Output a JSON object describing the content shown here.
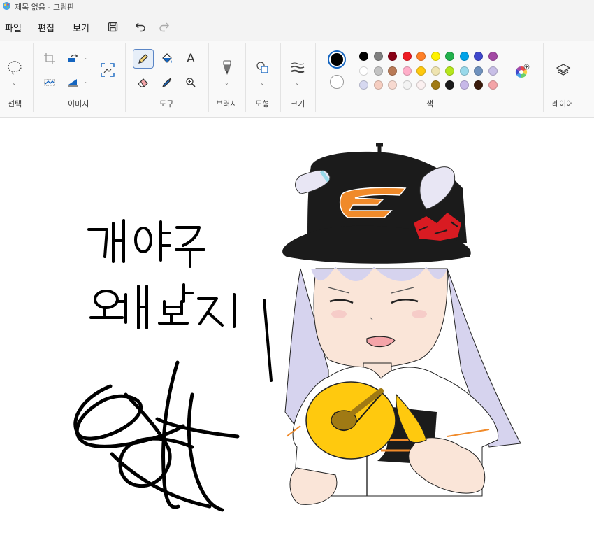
{
  "window": {
    "title": "제목 없음 - 그림판"
  },
  "menu": {
    "file": "파일",
    "edit": "편집",
    "view": "보기"
  },
  "quick_access": [
    "save-icon",
    "undo-icon",
    "redo-icon"
  ],
  "ribbon": {
    "groups": {
      "select": "선택",
      "image": "이미지",
      "tools": "도구",
      "brushes": "브러시",
      "shapes": "도형",
      "size": "크기",
      "colors": "색",
      "layers": "레이어"
    },
    "text_tool_glyph": "A",
    "active_tool": "pencil",
    "primary_color": "#000000",
    "secondary_color": "#ffffff",
    "palette_rows": [
      [
        "#000000",
        "#7f7f7f",
        "#880015",
        "#ed1c24",
        "#ff7f27",
        "#fff200",
        "#22b14c",
        "#00a2e8",
        "#3f48cc",
        "#a349a4"
      ],
      [
        "#ffffff",
        "#c3c3c3",
        "#b97a57",
        "#ffaec9",
        "#ffc90e",
        "#efe4b0",
        "#b5e61d",
        "#99d9ea",
        "#7092be",
        "#c8bfe7"
      ],
      [
        "#d6d8f0",
        "#f5cdc0",
        "#f7d9d0",
        "#f3f3f3",
        "#fbf0f0",
        "#a07a14",
        "#1b1b1b",
        "#c7b8e8",
        "#3a1b0c",
        "#f4a4a8"
      ]
    ]
  },
  "canvas": {
    "handwriting": [
      "개야구",
      "왜 봤지"
    ],
    "cap_logo": "E"
  }
}
